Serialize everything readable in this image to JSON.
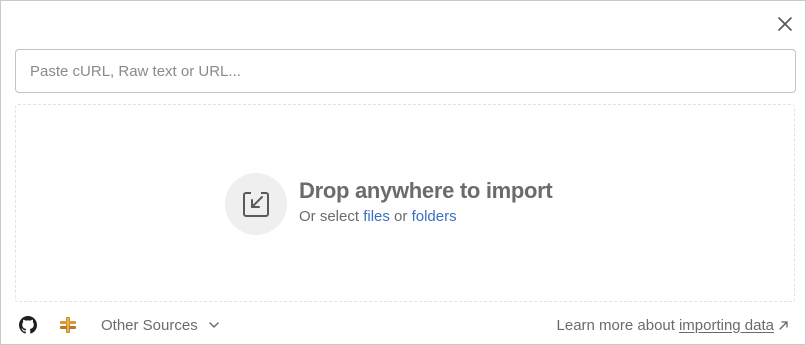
{
  "dialog": {
    "close_icon": "close-icon"
  },
  "input": {
    "placeholder": "Paste cURL, Raw text or URL...",
    "value": ""
  },
  "dropzone": {
    "icon": "import-arrow-icon",
    "title": "Drop anywhere to import",
    "subtitle_prefix": "Or select",
    "files_label": "files",
    "or_label": "or",
    "folders_label": "folders"
  },
  "footer": {
    "github_icon": "github-icon",
    "postman_icon": "postman-icon",
    "other_sources_label": "Other Sources",
    "learn_more_prefix": "Learn more about",
    "learn_more_link": "importing data"
  },
  "colors": {
    "link": "#3a6fc4",
    "text_muted": "#6b6b6b",
    "postman_orange": "#c98a2a"
  }
}
